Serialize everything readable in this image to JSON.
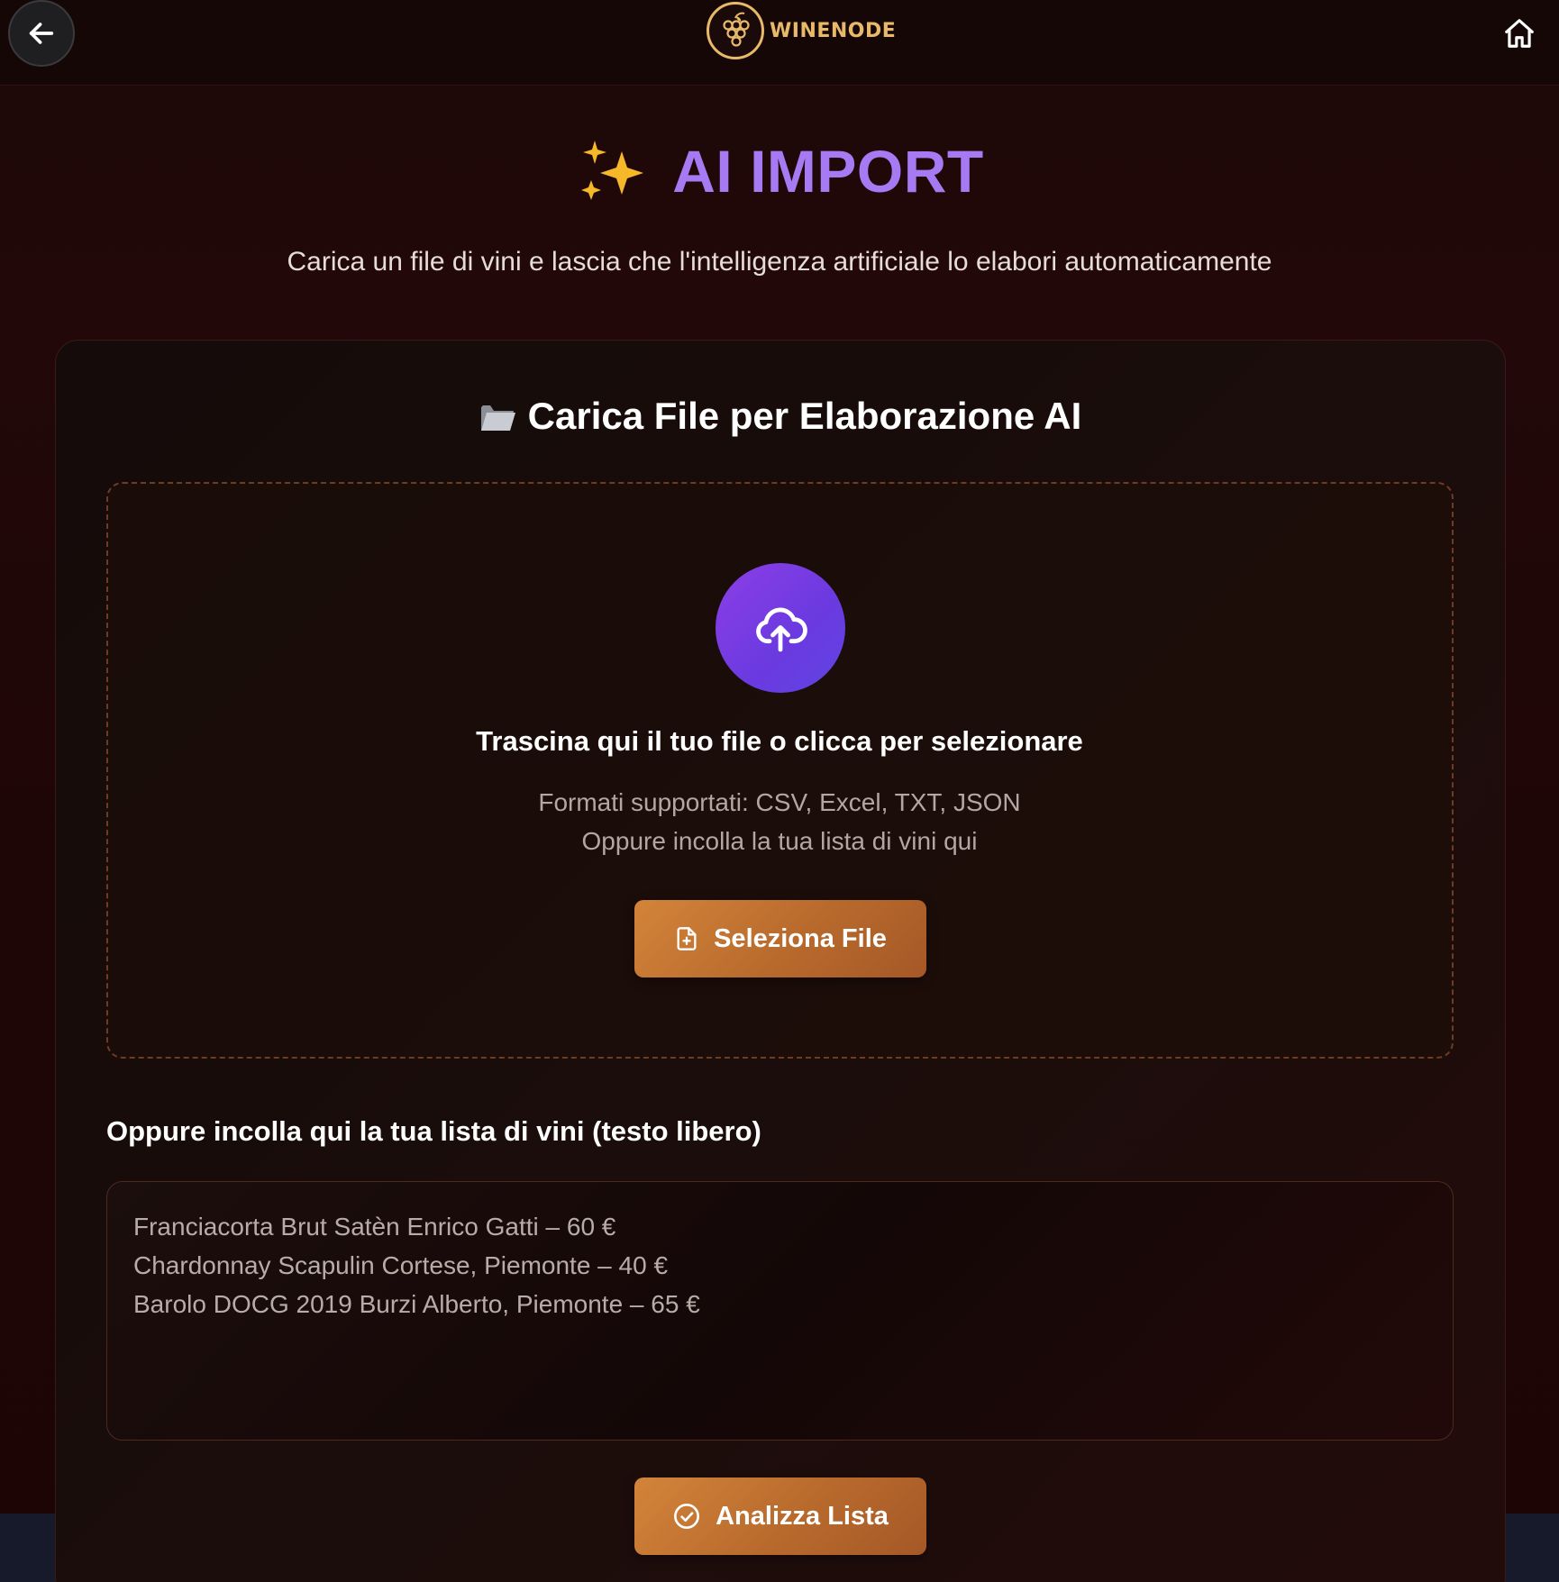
{
  "header": {
    "brand_name": "WINENODE",
    "back_icon": "arrow-left-icon",
    "home_icon": "home-icon",
    "logo_icon": "grapes-icon"
  },
  "hero": {
    "title": "AI IMPORT",
    "title_icon": "sparkles-icon",
    "subtitle": "Carica un file di vini e lascia che l'intelligenza artificiale lo elabori automaticamente"
  },
  "upload_card": {
    "title": "Carica File per Elaborazione AI",
    "title_icon": "folder-icon",
    "drop_title": "Trascina qui il tuo file o clicca per selezionare",
    "formats_text": "Formati supportati: CSV, Excel, TXT, JSON",
    "paste_hint": "Oppure incolla la tua lista di vini qui",
    "select_button": "Seleziona File",
    "upload_icon": "cloud-upload-icon"
  },
  "paste_section": {
    "label": "Oppure incolla qui la tua lista di vini (testo libero)",
    "lines": [
      "Franciacorta Brut Satèn Enrico Gatti – 60 €",
      "Chardonnay Scapulin Cortese, Piemonte – 40 €",
      "Barolo DOCG 2019 Burzi Alberto, Piemonte – 65 €"
    ],
    "analyze_button": "Analizza Lista"
  },
  "colors": {
    "accent_purple": "#a779f2",
    "brand_gold": "#e8b968",
    "button_orange": "#c7793a"
  }
}
